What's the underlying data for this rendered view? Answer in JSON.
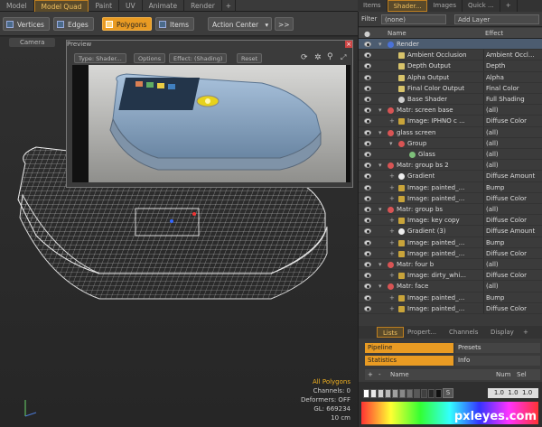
{
  "app": {
    "top_tabs": [
      "Model",
      "Model Quad",
      "Paint",
      "UV",
      "Animate",
      "Render",
      "+"
    ],
    "active_tab": "Model Quad"
  },
  "toolbar": {
    "vertices_label": "Vertices",
    "edges_label": "Edges",
    "polygons_label": "Polygons",
    "items_label": "Items",
    "action_center_label": "Action Center",
    "more_label": ">>"
  },
  "viewport": {
    "camera_tab": "Camera",
    "stats": {
      "selection_mode": "All Polygons",
      "channels": "Channels: 0",
      "deformers": "Deformers: OFF",
      "gl": "GL: 669234",
      "scale": "10 cm"
    }
  },
  "preview": {
    "title": "Preview",
    "type_label": "Type: Shader...",
    "options_label": "Options",
    "effect_label": "Effect: (Shading)",
    "reset_label": "Reset"
  },
  "panel": {
    "tabs": [
      "Items",
      "Shader...",
      "Images",
      "Quick ...",
      "+"
    ],
    "active_tab": "Shader...",
    "filter_label": "Filter",
    "filter_value": "(none)",
    "add_layer_label": "Add Layer",
    "col_name": "Name",
    "col_effect": "Effect"
  },
  "shader_tree": [
    {
      "name": "Render",
      "effect": "",
      "indent": 1,
      "icon": "render-icon",
      "expander": "▾",
      "selected": true
    },
    {
      "name": "Ambient Occlusion",
      "effect": "Ambient Occl...",
      "indent": 2,
      "icon": "output-icon",
      "expander": ""
    },
    {
      "name": "Depth Output",
      "effect": "Depth",
      "indent": 2,
      "icon": "output-icon",
      "expander": ""
    },
    {
      "name": "Alpha Output",
      "effect": "Alpha",
      "indent": 2,
      "icon": "output-icon",
      "expander": ""
    },
    {
      "name": "Final Color Output",
      "effect": "Final Color",
      "indent": 2,
      "icon": "output-icon",
      "expander": ""
    },
    {
      "name": "Base Shader",
      "effect": "Full Shading",
      "indent": 2,
      "icon": "shader-icon",
      "expander": ""
    },
    {
      "name": "Matr: screen base",
      "effect": "(all)",
      "indent": 1,
      "icon": "material-icon",
      "expander": "▾"
    },
    {
      "name": "Image: IPHNO c ...",
      "effect": "Diffuse Color",
      "indent": 2,
      "icon": "image-icon",
      "expander": "+"
    },
    {
      "name": "glass screen",
      "effect": "(all)",
      "indent": 1,
      "icon": "material-icon",
      "expander": "▾"
    },
    {
      "name": "Group",
      "effect": "(all)",
      "indent": 2,
      "icon": "group-icon",
      "expander": "▾"
    },
    {
      "name": "Glass",
      "effect": "(all)",
      "indent": 3,
      "icon": "glass-icon",
      "expander": ""
    },
    {
      "name": "Matr: group bs 2",
      "effect": "(all)",
      "indent": 1,
      "icon": "material-icon",
      "expander": "▾"
    },
    {
      "name": "Gradient",
      "effect": "Diffuse Amount",
      "indent": 2,
      "icon": "gradient-icon",
      "expander": "+"
    },
    {
      "name": "Image: painted_...",
      "effect": "Bump",
      "indent": 2,
      "icon": "image-icon",
      "expander": "+"
    },
    {
      "name": "Image: painted_...",
      "effect": "Diffuse Color",
      "indent": 2,
      "icon": "image-icon",
      "expander": "+"
    },
    {
      "name": "Matr: group bs",
      "effect": "(all)",
      "indent": 1,
      "icon": "material-icon",
      "expander": "▾"
    },
    {
      "name": "Image: key copy",
      "effect": "Diffuse Color",
      "indent": 2,
      "icon": "image-icon",
      "expander": "+"
    },
    {
      "name": "Gradient (3)",
      "effect": "Diffuse Amount",
      "indent": 2,
      "icon": "gradient-icon",
      "expander": "+"
    },
    {
      "name": "Image: painted_...",
      "effect": "Bump",
      "indent": 2,
      "icon": "image-icon",
      "expander": "+"
    },
    {
      "name": "Image: painted_...",
      "effect": "Diffuse Color",
      "indent": 2,
      "icon": "image-icon",
      "expander": "+"
    },
    {
      "name": "Matr: four b",
      "effect": "(all)",
      "indent": 1,
      "icon": "material-icon",
      "expander": "▾"
    },
    {
      "name": "Image: dirty_whi...",
      "effect": "Diffuse Color",
      "indent": 2,
      "icon": "image-icon",
      "expander": "+"
    },
    {
      "name": "Matr: face",
      "effect": "(all)",
      "indent": 1,
      "icon": "material-icon",
      "expander": "▾"
    },
    {
      "name": "Image: painted_...",
      "effect": "Bump",
      "indent": 2,
      "icon": "image-icon",
      "expander": "+"
    },
    {
      "name": "Image: painted_...",
      "effect": "Diffuse Color",
      "indent": 2,
      "icon": "image-icon",
      "expander": "+"
    }
  ],
  "lists": {
    "tabs": [
      "Lists",
      "Propert...",
      "Channels",
      "Display",
      "+"
    ],
    "active_tab": "Lists",
    "rows": [
      {
        "left": "Pipeline",
        "right": "Presets"
      },
      {
        "left": "Statistics",
        "right": "Info"
      }
    ],
    "header": {
      "add": "+",
      "remove": "-",
      "name": "Name",
      "num": "Num",
      "sel": "Sel"
    },
    "color_values": "1.0  1.0  1.0",
    "swatch_label": "S"
  },
  "watermark": "pxleyes.com",
  "colors": {
    "accent": "#e99b23",
    "selection": "#4c5c70"
  }
}
